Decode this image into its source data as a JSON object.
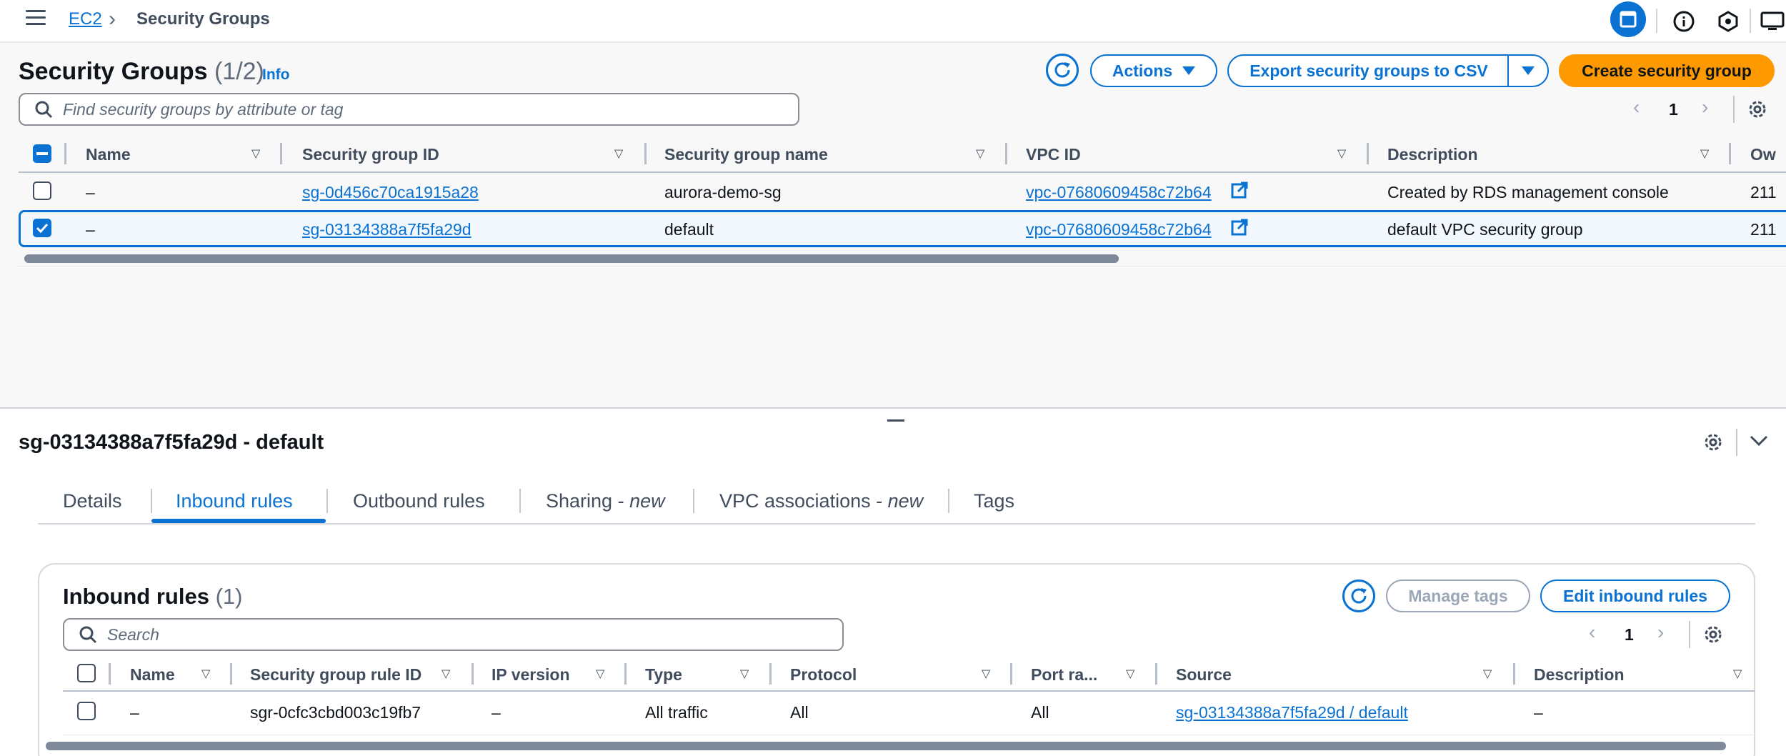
{
  "breadcrumb": {
    "root": "EC2",
    "current": "Security Groups"
  },
  "top_icons": [
    "window-icon",
    "info-icon",
    "hex-icon",
    "monitor-icon"
  ],
  "groups_panel": {
    "title": "Security Groups",
    "count": "(1/2)",
    "info": "Info",
    "actions_label": "Actions",
    "export_label": "Export security groups to CSV",
    "create_label": "Create security group",
    "search_placeholder": "Find security groups by attribute or tag",
    "page": "1",
    "columns": [
      "Name",
      "Security group ID",
      "Security group name",
      "VPC ID",
      "Description",
      "Ow"
    ],
    "rows": [
      {
        "selected": false,
        "name": "–",
        "id": "sg-0d456c70ca1915a28",
        "group_name": "aurora-demo-sg",
        "vpc": "vpc-07680609458c72b64",
        "description": "Created by RDS management console",
        "owner": "211"
      },
      {
        "selected": true,
        "name": "–",
        "id": "sg-03134388a7f5fa29d",
        "group_name": "default",
        "vpc": "vpc-07680609458c72b64",
        "description": "default VPC security group",
        "owner": "211"
      }
    ]
  },
  "detail": {
    "title": "sg-03134388a7f5fa29d - default",
    "tabs": [
      {
        "label": "Details",
        "suffix": ""
      },
      {
        "label": "Inbound rules",
        "suffix": ""
      },
      {
        "label": "Outbound rules",
        "suffix": ""
      },
      {
        "label": "Sharing - ",
        "suffix": "new"
      },
      {
        "label": "VPC associations - ",
        "suffix": "new"
      },
      {
        "label": "Tags",
        "suffix": ""
      }
    ],
    "active_tab": "Inbound rules"
  },
  "inbound": {
    "title": "Inbound rules",
    "count": "(1)",
    "manage_tags": "Manage tags",
    "edit_label": "Edit inbound rules",
    "search_placeholder": "Search",
    "page": "1",
    "columns": [
      "Name",
      "Security group rule ID",
      "IP version",
      "Type",
      "Protocol",
      "Port ra...",
      "Source",
      "Description"
    ],
    "rows": [
      {
        "name": "–",
        "rule_id": "sgr-0cfc3cbd003c19fb7",
        "ip_version": "–",
        "type": "All traffic",
        "protocol": "All",
        "port": "All",
        "source": "sg-03134388a7f5fa29d / default",
        "description": "–"
      }
    ]
  },
  "colors": {
    "accent": "#0972d3",
    "primary_button": "#ff9900",
    "selected_row": "#f2f8fd"
  }
}
